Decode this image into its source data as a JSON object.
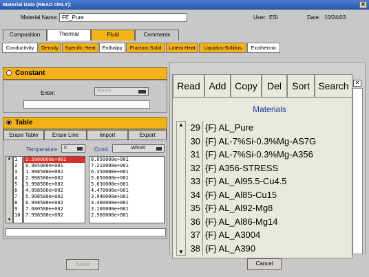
{
  "window": {
    "title": "Material Data (READ ONLY):",
    "close": "✕"
  },
  "header": {
    "material_label": "Material Name:",
    "material_value": "FE_Pure",
    "user_label": "User:",
    "user_value": "ESI",
    "date_label": "Date:",
    "date_value": "10/24/03"
  },
  "tabs": [
    "Composition",
    "Thermal",
    "Fluid",
    "Comments"
  ],
  "subtabs": [
    "Conductivity",
    "Density",
    "Specific Heat",
    "Enthalpy",
    "Fraction Solid",
    "Latent Heat",
    "Liquidus-Solidus",
    "Exothermic"
  ],
  "constant": {
    "title": "Constant",
    "enter_label": "Enter:",
    "unit_value": "W/m/K"
  },
  "table_section": {
    "title": "Table",
    "buttons": [
      "Erase Table",
      "Erase Line",
      "Import",
      "Export"
    ],
    "temp_label": "Temperature",
    "temp_unit": "C",
    "cond_label": "Cond.",
    "cond_unit": "W/m/K",
    "rows": [
      {
        "n": "1",
        "t": "2.5000000e+001",
        "c": "8.050000e+001"
      },
      {
        "n": "2",
        "t": "9.985000e+001",
        "c": "7.210000e+001"
      },
      {
        "n": "3",
        "t": "1.998500e+002",
        "c": "6.350000e+001"
      },
      {
        "n": "4",
        "t": "2.998500e+002",
        "c": "5.650000e+001"
      },
      {
        "n": "5",
        "t": "3.998500e+002",
        "c": "5.030000e+001"
      },
      {
        "n": "6",
        "t": "4.998500e+002",
        "c": "4.470000e+001"
      },
      {
        "n": "7",
        "t": "5.998500e+002",
        "c": "3.940000e+001"
      },
      {
        "n": "8",
        "t": "6.998500e+002",
        "c": "3.400000e+001"
      },
      {
        "n": "9",
        "t": "7.680500e+002",
        "c": "3.100000e+001"
      },
      {
        "n": "10",
        "t": "7.998500e+002",
        "c": "2.960000e+001"
      }
    ]
  },
  "footer": {
    "store": "Store",
    "cancel": "Cancel"
  },
  "materials": {
    "toolbar": [
      "Read",
      "Add",
      "Copy",
      "Del",
      "Sort",
      "Search"
    ],
    "title": "Materials",
    "items": [
      {
        "n": "29",
        "name": "{F} AL_Pure"
      },
      {
        "n": "30",
        "name": "{F} AL-7%Si-0.3%Mg-AS7G"
      },
      {
        "n": "31",
        "name": "{F} AL-7%Si-0.3%Mg-A356"
      },
      {
        "n": "32",
        "name": "{F} A356-STRESS"
      },
      {
        "n": "33",
        "name": "{F} AL_Al95.5-Cu4.5"
      },
      {
        "n": "34",
        "name": "{F} AL_Al85-Cu15"
      },
      {
        "n": "35",
        "name": "{F} AL_Al92-Mg8"
      },
      {
        "n": "36",
        "name": "{F} AL_Al86-Mg14"
      },
      {
        "n": "37",
        "name": "{F} AL_A3004"
      },
      {
        "n": "38",
        "name": "{F} AL_A390"
      }
    ]
  },
  "colors": {
    "accent": "#f3b21a",
    "title_blue": "#2a55a8",
    "selected_red": "#d9302a"
  }
}
